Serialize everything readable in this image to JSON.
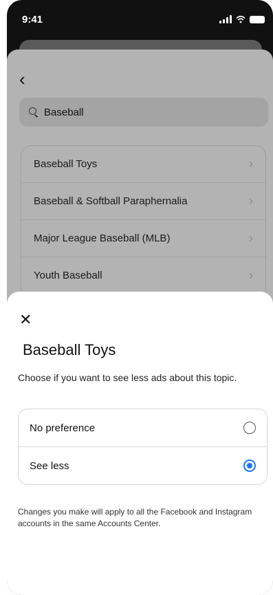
{
  "status_bar": {
    "time": "9:41"
  },
  "search": {
    "query": "Baseball"
  },
  "topics": [
    {
      "label": "Baseball Toys"
    },
    {
      "label": "Baseball & Softball Paraphernalia"
    },
    {
      "label": "Major League Baseball (MLB)"
    },
    {
      "label": "Youth Baseball"
    }
  ],
  "modal": {
    "title": "Baseball Toys",
    "description": "Choose if you want to see less ads about this topic.",
    "options": [
      {
        "label": "No preference",
        "selected": false
      },
      {
        "label": "See less",
        "selected": true
      }
    ],
    "footer": "Changes you make will apply to all the Facebook and Instagram accounts in the same Accounts Center."
  },
  "colors": {
    "accent": "#1877f2"
  }
}
